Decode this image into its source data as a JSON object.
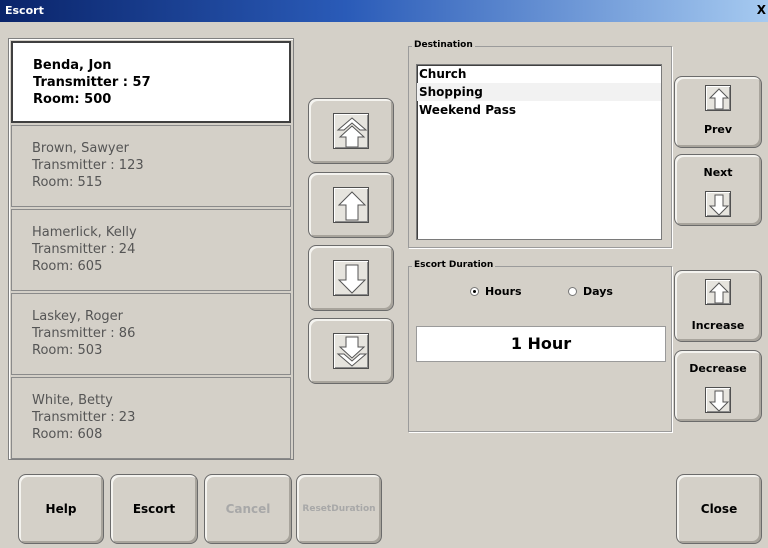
{
  "window": {
    "title": "Escort",
    "close_glyph": "X"
  },
  "residents": [
    {
      "name": "Benda, Jon",
      "transmitter": "Transmitter : 57",
      "room": "Room: 500",
      "selected": true
    },
    {
      "name": "Brown, Sawyer",
      "transmitter": "Transmitter : 123",
      "room": "Room: 515",
      "selected": false
    },
    {
      "name": "Hamerlick, Kelly",
      "transmitter": "Transmitter : 24",
      "room": "Room: 605",
      "selected": false
    },
    {
      "name": "Laskey, Roger",
      "transmitter": "Transmitter : 86",
      "room": "Room: 503",
      "selected": false
    },
    {
      "name": "White, Betty",
      "transmitter": "Transmitter : 23",
      "room": "Room: 608",
      "selected": false
    }
  ],
  "nav_buttons": [
    "double-up-arrow-icon",
    "up-arrow-icon",
    "down-arrow-icon",
    "double-down-arrow-icon"
  ],
  "destination": {
    "label": "Destination",
    "items": [
      "Church",
      "Shopping",
      "Weekend Pass"
    ],
    "highlighted_index": 1,
    "prev_label": "Prev",
    "next_label": "Next"
  },
  "escort_duration": {
    "label": "Escort Duration",
    "hours_label": "Hours",
    "days_label": "Days",
    "selected_unit": "Hours",
    "value": "1 Hour",
    "increase_label": "Increase",
    "decrease_label": "Decrease"
  },
  "bottom_buttons": {
    "help": "Help",
    "escort": "Escort",
    "cancel": "Cancel",
    "reset_duration_1": "Reset",
    "reset_duration_2": "Duration",
    "close": "Close"
  },
  "colors": {
    "window_bg": "#d4d0c8",
    "titlebar_start": "#0a246a",
    "titlebar_end": "#a6caf0",
    "selected_bg": "#ffffff",
    "disabled_text": "#a8a8a8"
  }
}
